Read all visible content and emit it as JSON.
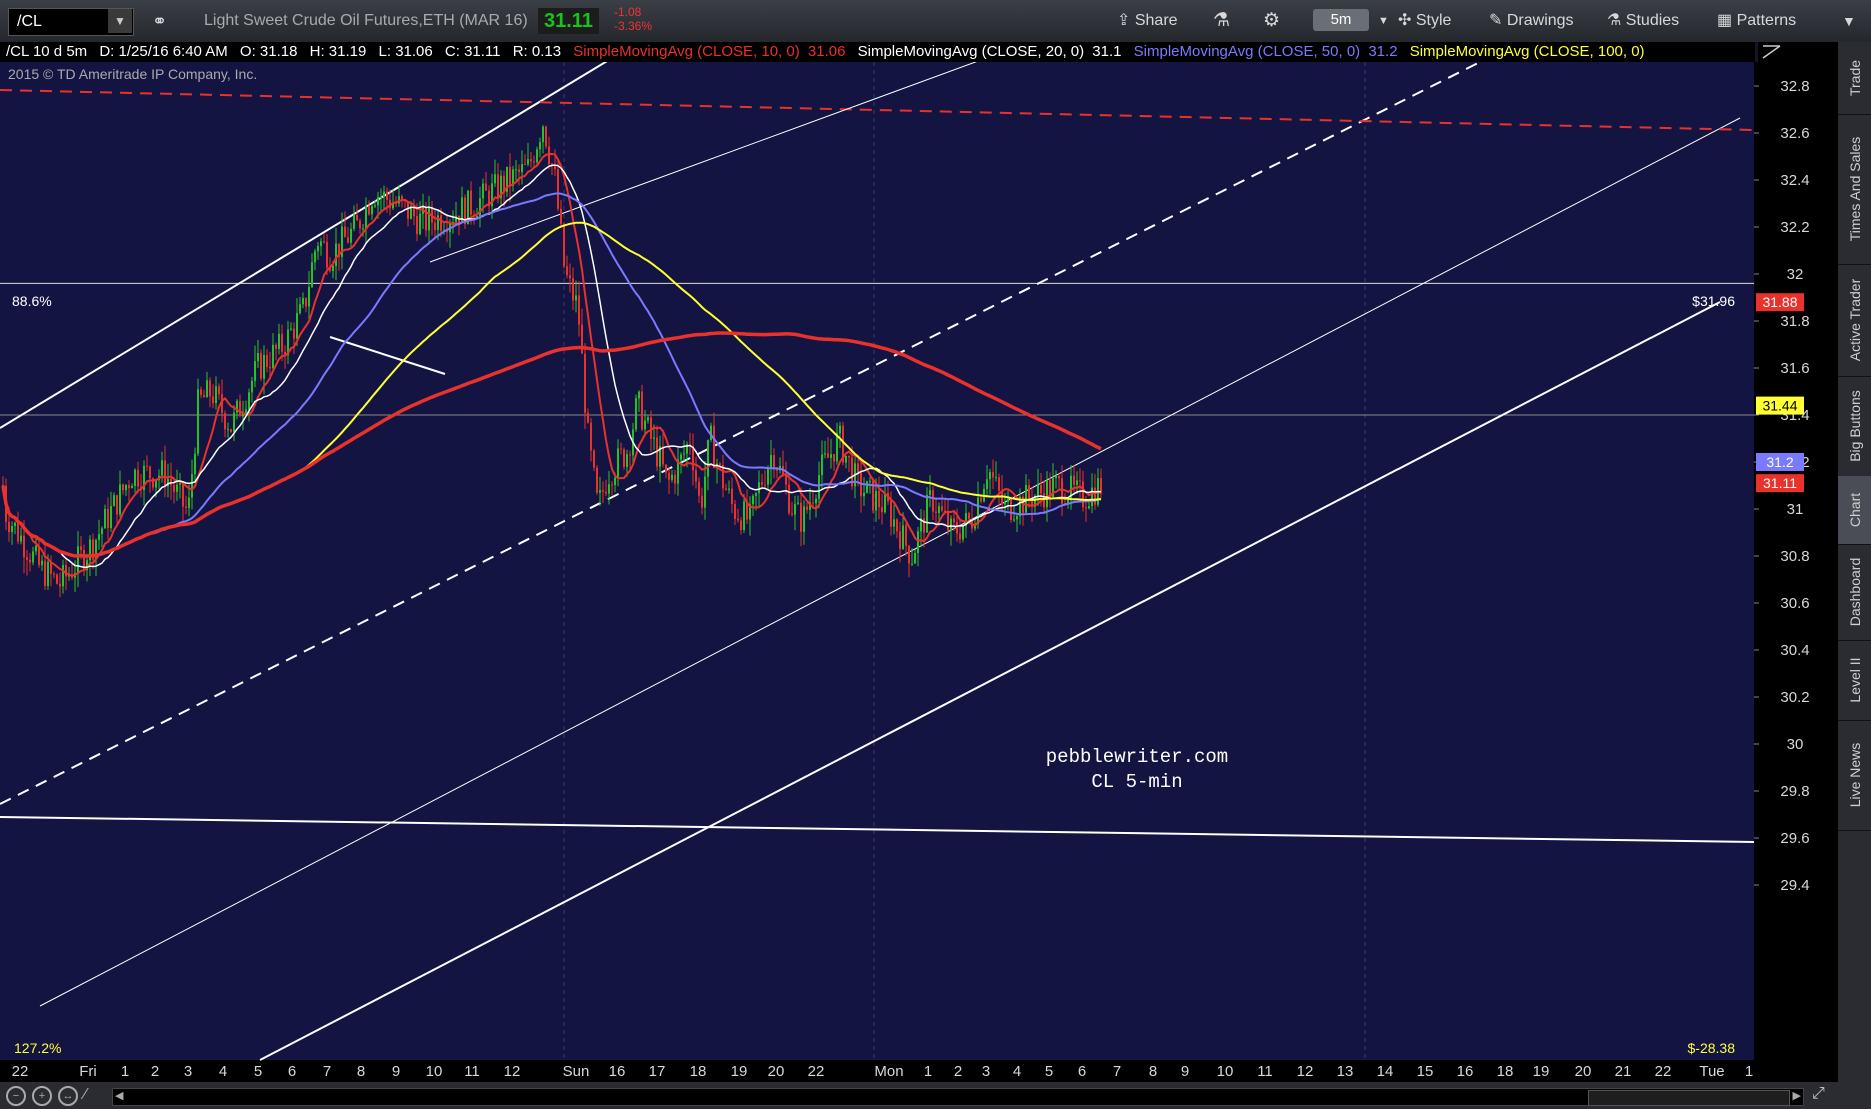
{
  "toolbar": {
    "symbol": "/CL",
    "description": "Light Sweet Crude Oil Futures,ETH (MAR 16)",
    "last_price": "31.11",
    "net_change": "-1.08",
    "pct_change": "-3.36%",
    "share_label": "Share",
    "timeframe": "5m",
    "style_label": "Style",
    "drawings_label": "Drawings",
    "studies_label": "Studies",
    "patterns_label": "Patterns"
  },
  "studybar": {
    "symbol": "/CL 10 d 5m",
    "date": "D: 1/25/16 6:40 AM",
    "open": "O: 31.18",
    "high": "H: 31.19",
    "low": "L: 31.06",
    "close": "C: 31.11",
    "range": "R: 0.13",
    "sma10_label": "SimpleMovingAvg (CLOSE, 10, 0)",
    "sma10_value": "31.06",
    "sma20_label": "SimpleMovingAvg (CLOSE, 20, 0)",
    "sma20_value": "31.1",
    "sma50_label": "SimpleMovingAvg (CLOSE, 50, 0)",
    "sma50_value": "31.2",
    "sma100_label": "SimpleMovingAvg (CLOSE, 100, 0)"
  },
  "copyright": "2015 © TD Ameritrade IP Company, Inc.",
  "sidebar": {
    "tabs": [
      "Trade",
      "Times And Sales",
      "Active Trader",
      "Big Buttons",
      "Chart",
      "Dashboard",
      "Level II",
      "Live News"
    ]
  },
  "colors": {
    "background": "#141442",
    "sma10": "#e8322b",
    "sma20": "#ffffff",
    "sma50": "#7a7aff",
    "sma100": "#ffff33",
    "sma200": "#e8322b",
    "candle_up": "#27c227",
    "candle_down": "#e8322b"
  },
  "chart_data": {
    "type": "candlestick",
    "title": "Light Sweet Crude Oil Futures,ETH (MAR 16)",
    "ylim": [
      29.3,
      32.85
    ],
    "y_ticks": [
      "32.8",
      "32.6",
      "32.4",
      "32.2",
      "32",
      "31.8",
      "31.6",
      "31.4",
      "31.2",
      "31",
      "30.8",
      "30.6",
      "30.4",
      "30.2",
      "30",
      "29.8",
      "29.6",
      "29.4"
    ],
    "x_ticks": [
      "22",
      "Fri",
      "1",
      "2",
      "3",
      "4",
      "5",
      "6",
      "7",
      "8",
      "9",
      "10",
      "11",
      "12",
      "Sun",
      "16",
      "17",
      "18",
      "19",
      "20",
      "22",
      "Mon",
      "1",
      "2",
      "3",
      "4",
      "5",
      "6",
      "7",
      "8",
      "9",
      "10",
      "11",
      "12",
      "13",
      "14",
      "15",
      "16",
      "18",
      "19",
      "20",
      "21",
      "22",
      "Tue",
      "1"
    ],
    "price_labels": [
      {
        "value": 31.88,
        "text": "31.88",
        "color": "#e8322b",
        "text_color": "#ffffff"
      },
      {
        "value": 31.44,
        "text": "31.44",
        "color": "#ffff33",
        "text_color": "#000000"
      },
      {
        "value": 31.2,
        "text": "31.2",
        "color": "#7a7aff",
        "text_color": "#ffffff"
      },
      {
        "value": 31.11,
        "text": "31.11",
        "color": "#e8322b",
        "text_color": "#ffffff"
      }
    ],
    "horizontal_levels": [
      {
        "value": 31.96,
        "left_label": "88.6%",
        "right_label": "$31.96"
      },
      {
        "value": 31.4
      }
    ],
    "bottom_left_label": "127.2%",
    "bottom_right_label": "$-28.38",
    "series": [
      {
        "name": "SimpleMovingAvg (CLOSE, 10, 0)",
        "color": "#e8322b",
        "last": 31.06
      },
      {
        "name": "SimpleMovingAvg (CLOSE, 20, 0)",
        "color": "#ffffff",
        "last": 31.1
      },
      {
        "name": "SimpleMovingAvg (CLOSE, 50, 0)",
        "color": "#7a7aff",
        "last": 31.2
      },
      {
        "name": "SimpleMovingAvg (CLOSE, 100, 0)",
        "color": "#ffff33",
        "last": 31.44
      },
      {
        "color": "#e8322b",
        "last": 31.88
      }
    ],
    "annotations": [
      "pebblewriter.com",
      "CL 5-min"
    ]
  }
}
